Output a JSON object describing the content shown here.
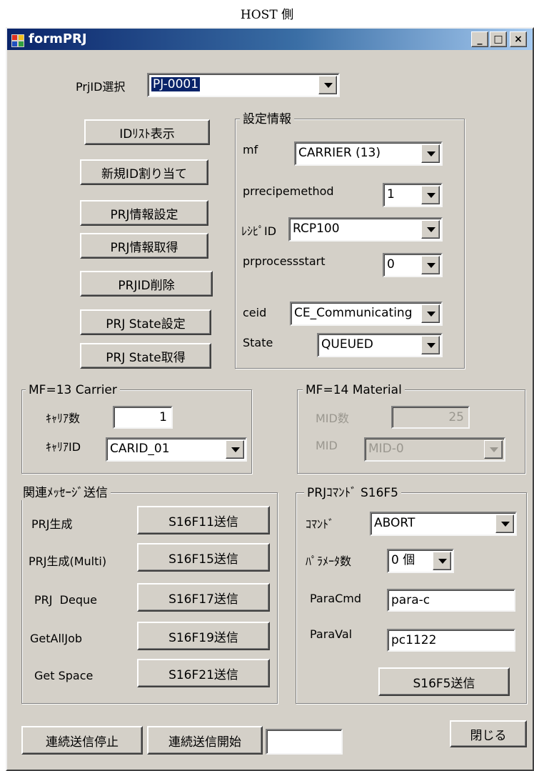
{
  "caption": "HOST 側",
  "window": {
    "title": "formPRJ",
    "controls": {
      "minimize": "_",
      "maximize": "□",
      "close": "×"
    }
  },
  "top": {
    "prjid_label": "PrjID選択",
    "prjid_value": "PJ-0001"
  },
  "left_buttons": [
    "IDﾘｽﾄ表示",
    "新規ID割り当て",
    "PRJ情報設定",
    "PRJ情報取得",
    "PRJID削除",
    "PRJ State設定",
    "PRJ State取得"
  ],
  "settings": {
    "legend": "設定情報",
    "mf_label": "mf",
    "mf_value": "CARRIER (13)",
    "prrecipemethod_label": "prrecipemethod",
    "prrecipemethod_value": "1",
    "recipe_label": "ﾚｼﾋﾟID",
    "recipe_value": "RCP100",
    "prprocessstart_label": "prprocessstart",
    "prprocessstart_value": "0",
    "ceid_label": "ceid",
    "ceid_value": "CE_Communicating",
    "state_label": "State",
    "state_value": "QUEUED"
  },
  "carrier": {
    "legend": "MF=13 Carrier",
    "count_label": "ｷｬﾘｱ数",
    "count_value": "1",
    "id_label": "ｷｬﾘｱID",
    "id_value": "CARID_01"
  },
  "material": {
    "legend": "MF=14 Material",
    "count_label": "MID数",
    "count_value": "25",
    "mid_label": "MID",
    "mid_value": "MID-0"
  },
  "messages": {
    "legend": "関連ﾒｯｾｰｼﾞ送信",
    "rows": [
      {
        "label": "PRJ生成",
        "button": "S16F11送信"
      },
      {
        "label": "PRJ生成(Multi)",
        "button": "S16F15送信"
      },
      {
        "label": "PRJ  Deque",
        "button": "S16F17送信"
      },
      {
        "label": "GetAllJob",
        "button": "S16F19送信"
      },
      {
        "label": "Get Space",
        "button": "S16F21送信"
      }
    ]
  },
  "command": {
    "legend": "PRJｺﾏﾝﾄﾞ S16F5",
    "cmd_label": "ｺﾏﾝﾄﾞ",
    "cmd_value": "ABORT",
    "param_count_label": "ﾊﾟﾗﾒｰﾀ数",
    "param_count_value": "0 個",
    "paracmd_label": "ParaCmd",
    "paracmd_value": "para-c",
    "paraval_label": "ParaVal",
    "paraval_value": "pc1122",
    "send_button": "S16F5送信"
  },
  "bottom": {
    "stop_button": "連続送信停止",
    "start_button": "連続送信開始",
    "interval_value": "",
    "close_button": "閉じる"
  }
}
